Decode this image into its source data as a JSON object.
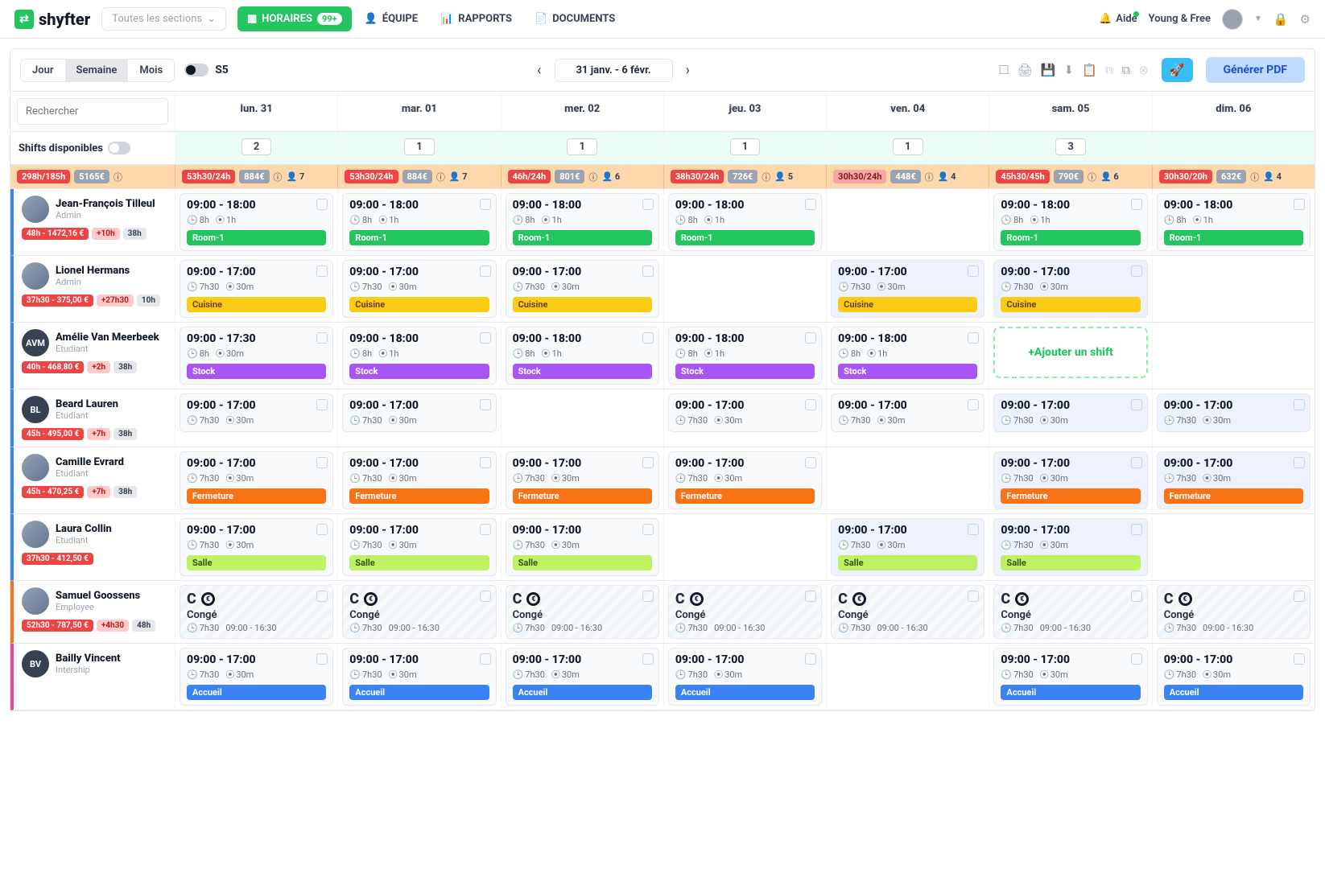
{
  "brand": "shyfter",
  "sectionsDropdown": "Toutes les sections",
  "nav": {
    "horaires": "HORAIRES",
    "horairesBadge": "99+",
    "equipe": "ÉQUIPE",
    "rapports": "RAPPORTS",
    "documents": "DOCUMENTS"
  },
  "topright": {
    "aide": "Aide",
    "account": "Young & Free"
  },
  "viewModes": {
    "jour": "Jour",
    "semaine": "Semaine",
    "mois": "Mois"
  },
  "weekLabel": "S5",
  "dateRange": "31 janv. - 6 févr.",
  "pdfBtn": "Générer PDF",
  "searchPlaceholder": "Rechercher",
  "shiftsAvailLabel": "Shifts disponibles",
  "addShiftLabel": "+Ajouter un shift",
  "days": [
    {
      "label": "lun. 31",
      "avail": "2",
      "hours": "53h30/24h",
      "cost": "884€",
      "people": "7"
    },
    {
      "label": "mar. 01",
      "avail": "1",
      "hours": "53h30/24h",
      "cost": "884€",
      "people": "7"
    },
    {
      "label": "mer. 02",
      "avail": "1",
      "hours": "46h/24h",
      "cost": "801€",
      "people": "6"
    },
    {
      "label": "jeu. 03",
      "avail": "1",
      "hours": "38h30/24h",
      "cost": "726€",
      "people": "5"
    },
    {
      "label": "ven. 04",
      "avail": "1",
      "hours": "30h30/24h",
      "cost": "448€",
      "people": "4"
    },
    {
      "label": "sam. 05",
      "avail": "3",
      "hours": "45h30/45h",
      "cost": "790€",
      "people": "6"
    },
    {
      "label": "dim. 06",
      "avail": "",
      "hours": "30h30/20h",
      "cost": "632€",
      "people": "4"
    }
  ],
  "totals": {
    "hours": "298h/185h",
    "cost": "5165€"
  },
  "people": [
    {
      "name": "Jean-François Tilleul",
      "role": "Admin",
      "accent": "#3b82f6",
      "initials": "",
      "hasPhoto": true,
      "tags": [
        {
          "t": "48h - 1472,16 €",
          "c": "red"
        },
        {
          "t": "+10h",
          "c": "pink"
        },
        {
          "t": "38h",
          "c": "gray"
        }
      ],
      "shifts": [
        {
          "time": "09:00 - 18:00",
          "dur": "8h",
          "brk": "1h",
          "cat": "Room-1",
          "catc": "green"
        },
        {
          "time": "09:00 - 18:00",
          "dur": "8h",
          "brk": "1h",
          "cat": "Room-1",
          "catc": "green"
        },
        {
          "time": "09:00 - 18:00",
          "dur": "8h",
          "brk": "1h",
          "cat": "Room-1",
          "catc": "green"
        },
        {
          "time": "09:00 - 18:00",
          "dur": "8h",
          "brk": "1h",
          "cat": "Room-1",
          "catc": "green"
        },
        null,
        {
          "time": "09:00 - 18:00",
          "dur": "8h",
          "brk": "1h",
          "cat": "Room-1",
          "catc": "green"
        },
        {
          "time": "09:00 - 18:00",
          "dur": "8h",
          "brk": "1h",
          "cat": "Room-1",
          "catc": "green"
        }
      ]
    },
    {
      "name": "Lionel Hermans",
      "role": "Admin",
      "accent": "#3b82f6",
      "initials": "",
      "hasPhoto": true,
      "tags": [
        {
          "t": "37h30 - 375,00 €",
          "c": "red"
        },
        {
          "t": "+27h30",
          "c": "pink"
        },
        {
          "t": "10h",
          "c": "gray"
        }
      ],
      "shifts": [
        {
          "time": "09:00 - 17:00",
          "dur": "7h30",
          "brk": "30m",
          "cat": "Cuisine",
          "catc": "yellow"
        },
        {
          "time": "09:00 - 17:00",
          "dur": "7h30",
          "brk": "30m",
          "cat": "Cuisine",
          "catc": "yellow"
        },
        {
          "time": "09:00 - 17:00",
          "dur": "7h30",
          "brk": "30m",
          "cat": "Cuisine",
          "catc": "yellow"
        },
        null,
        {
          "time": "09:00 - 17:00",
          "dur": "7h30",
          "brk": "30m",
          "cat": "Cuisine",
          "catc": "yellow",
          "hl": true
        },
        {
          "time": "09:00 - 17:00",
          "dur": "7h30",
          "brk": "30m",
          "cat": "Cuisine",
          "catc": "yellow",
          "hl": true
        },
        null
      ]
    },
    {
      "name": "Amélie Van Meerbeek",
      "role": "Etudiant",
      "accent": "#3b82f6",
      "initials": "AVM",
      "tags": [
        {
          "t": "40h - 468,80 €",
          "c": "red"
        },
        {
          "t": "+2h",
          "c": "pink"
        },
        {
          "t": "38h",
          "c": "gray"
        }
      ],
      "shifts": [
        {
          "time": "09:00 - 17:30",
          "dur": "8h",
          "brk": "30m",
          "cat": "Stock",
          "catc": "purple"
        },
        {
          "time": "09:00 - 18:00",
          "dur": "8h",
          "brk": "1h",
          "cat": "Stock",
          "catc": "purple"
        },
        {
          "time": "09:00 - 18:00",
          "dur": "8h",
          "brk": "1h",
          "cat": "Stock",
          "catc": "purple"
        },
        {
          "time": "09:00 - 18:00",
          "dur": "8h",
          "brk": "1h",
          "cat": "Stock",
          "catc": "purple"
        },
        {
          "time": "09:00 - 18:00",
          "dur": "8h",
          "brk": "1h",
          "cat": "Stock",
          "catc": "purple"
        },
        {
          "add": true
        },
        null
      ]
    },
    {
      "name": "Beard Lauren",
      "role": "Etudiant",
      "accent": "#3b82f6",
      "initials": "BL",
      "tags": [
        {
          "t": "45h - 495,00 €",
          "c": "red"
        },
        {
          "t": "+7h",
          "c": "pink"
        },
        {
          "t": "38h",
          "c": "gray"
        }
      ],
      "shifts": [
        {
          "time": "09:00 - 17:00",
          "dur": "7h30",
          "brk": "30m"
        },
        {
          "time": "09:00 - 17:00",
          "dur": "7h30",
          "brk": "30m"
        },
        null,
        {
          "time": "09:00 - 17:00",
          "dur": "7h30",
          "brk": "30m"
        },
        {
          "time": "09:00 - 17:00",
          "dur": "7h30",
          "brk": "30m"
        },
        {
          "time": "09:00 - 17:00",
          "dur": "7h30",
          "brk": "30m",
          "hl": true
        },
        {
          "time": "09:00 - 17:00",
          "dur": "7h30",
          "brk": "30m",
          "hl": true
        }
      ]
    },
    {
      "name": "Camille Evrard",
      "role": "Etudiant",
      "accent": "#3b82f6",
      "initials": "",
      "hasPhoto": true,
      "tags": [
        {
          "t": "45h - 470,25 €",
          "c": "red"
        },
        {
          "t": "+7h",
          "c": "pink"
        },
        {
          "t": "38h",
          "c": "gray"
        }
      ],
      "shifts": [
        {
          "time": "09:00 - 17:00",
          "dur": "7h30",
          "brk": "30m",
          "cat": "Fermeture",
          "catc": "orange"
        },
        {
          "time": "09:00 - 17:00",
          "dur": "7h30",
          "brk": "30m",
          "cat": "Fermeture",
          "catc": "orange"
        },
        {
          "time": "09:00 - 17:00",
          "dur": "7h30",
          "brk": "30m",
          "cat": "Fermeture",
          "catc": "orange"
        },
        {
          "time": "09:00 - 17:00",
          "dur": "7h30",
          "brk": "30m",
          "cat": "Fermeture",
          "catc": "orange"
        },
        null,
        {
          "time": "09:00 - 17:00",
          "dur": "7h30",
          "brk": "30m",
          "cat": "Fermeture",
          "catc": "orange",
          "hl": true
        },
        {
          "time": "09:00 - 17:00",
          "dur": "7h30",
          "brk": "30m",
          "cat": "Fermeture",
          "catc": "orange",
          "hl": true
        }
      ]
    },
    {
      "name": "Laura Collin",
      "role": "Etudiant",
      "accent": "#3b82f6",
      "initials": "",
      "hasPhoto": true,
      "tags": [
        {
          "t": "37h30 - 412,50 €",
          "c": "red"
        }
      ],
      "shifts": [
        {
          "time": "09:00 - 17:00",
          "dur": "7h30",
          "brk": "30m",
          "cat": "Salle",
          "catc": "lime"
        },
        {
          "time": "09:00 - 17:00",
          "dur": "7h30",
          "brk": "30m",
          "cat": "Salle",
          "catc": "lime"
        },
        {
          "time": "09:00 - 17:00",
          "dur": "7h30",
          "brk": "30m",
          "cat": "Salle",
          "catc": "lime"
        },
        null,
        {
          "time": "09:00 - 17:00",
          "dur": "7h30",
          "brk": "30m",
          "cat": "Salle",
          "catc": "lime",
          "hl": true
        },
        {
          "time": "09:00 - 17:00",
          "dur": "7h30",
          "brk": "30m",
          "cat": "Salle",
          "catc": "lime",
          "hl": true
        },
        null
      ]
    },
    {
      "name": "Samuel Goossens",
      "role": "Employee",
      "accent": "#f97316",
      "initials": "",
      "hasPhoto": true,
      "tags": [
        {
          "t": "52h30 - 787,50 €",
          "c": "red"
        },
        {
          "t": "+4h30",
          "c": "pink"
        },
        {
          "t": "48h",
          "c": "gray"
        }
      ],
      "shifts": [
        {
          "conge": true,
          "label": "Congé",
          "dur": "7h30",
          "range": "09:00 - 16:30"
        },
        {
          "conge": true,
          "label": "Congé",
          "dur": "7h30",
          "range": "09:00 - 16:30"
        },
        {
          "conge": true,
          "label": "Congé",
          "dur": "7h30",
          "range": "09:00 - 16:30"
        },
        {
          "conge": true,
          "label": "Congé",
          "dur": "7h30",
          "range": "09:00 - 16:30"
        },
        {
          "conge": true,
          "label": "Congé",
          "dur": "7h30",
          "range": "09:00 - 16:30"
        },
        {
          "conge": true,
          "label": "Congé",
          "dur": "7h30",
          "range": "09:00 - 16:30"
        },
        {
          "conge": true,
          "label": "Congé",
          "dur": "7h30",
          "range": "09:00 - 16:30"
        }
      ]
    },
    {
      "name": "Bailly Vincent",
      "role": "Intership",
      "accent": "#ec4899",
      "initials": "BV",
      "tags": [],
      "shifts": [
        {
          "time": "09:00 - 17:00",
          "dur": "7h30",
          "brk": "30m",
          "cat": "Accueil",
          "catc": "blue"
        },
        {
          "time": "09:00 - 17:00",
          "dur": "7h30",
          "brk": "30m",
          "cat": "Accueil",
          "catc": "blue"
        },
        {
          "time": "09:00 - 17:00",
          "dur": "7h30",
          "brk": "30m",
          "cat": "Accueil",
          "catc": "blue"
        },
        {
          "time": "09:00 - 17:00",
          "dur": "7h30",
          "brk": "30m",
          "cat": "Accueil",
          "catc": "blue"
        },
        null,
        {
          "time": "09:00 - 17:00",
          "dur": "7h30",
          "brk": "30m",
          "cat": "Accueil",
          "catc": "blue"
        },
        {
          "time": "09:00 - 17:00",
          "dur": "7h30",
          "brk": "30m",
          "cat": "Accueil",
          "catc": "blue"
        }
      ]
    }
  ]
}
